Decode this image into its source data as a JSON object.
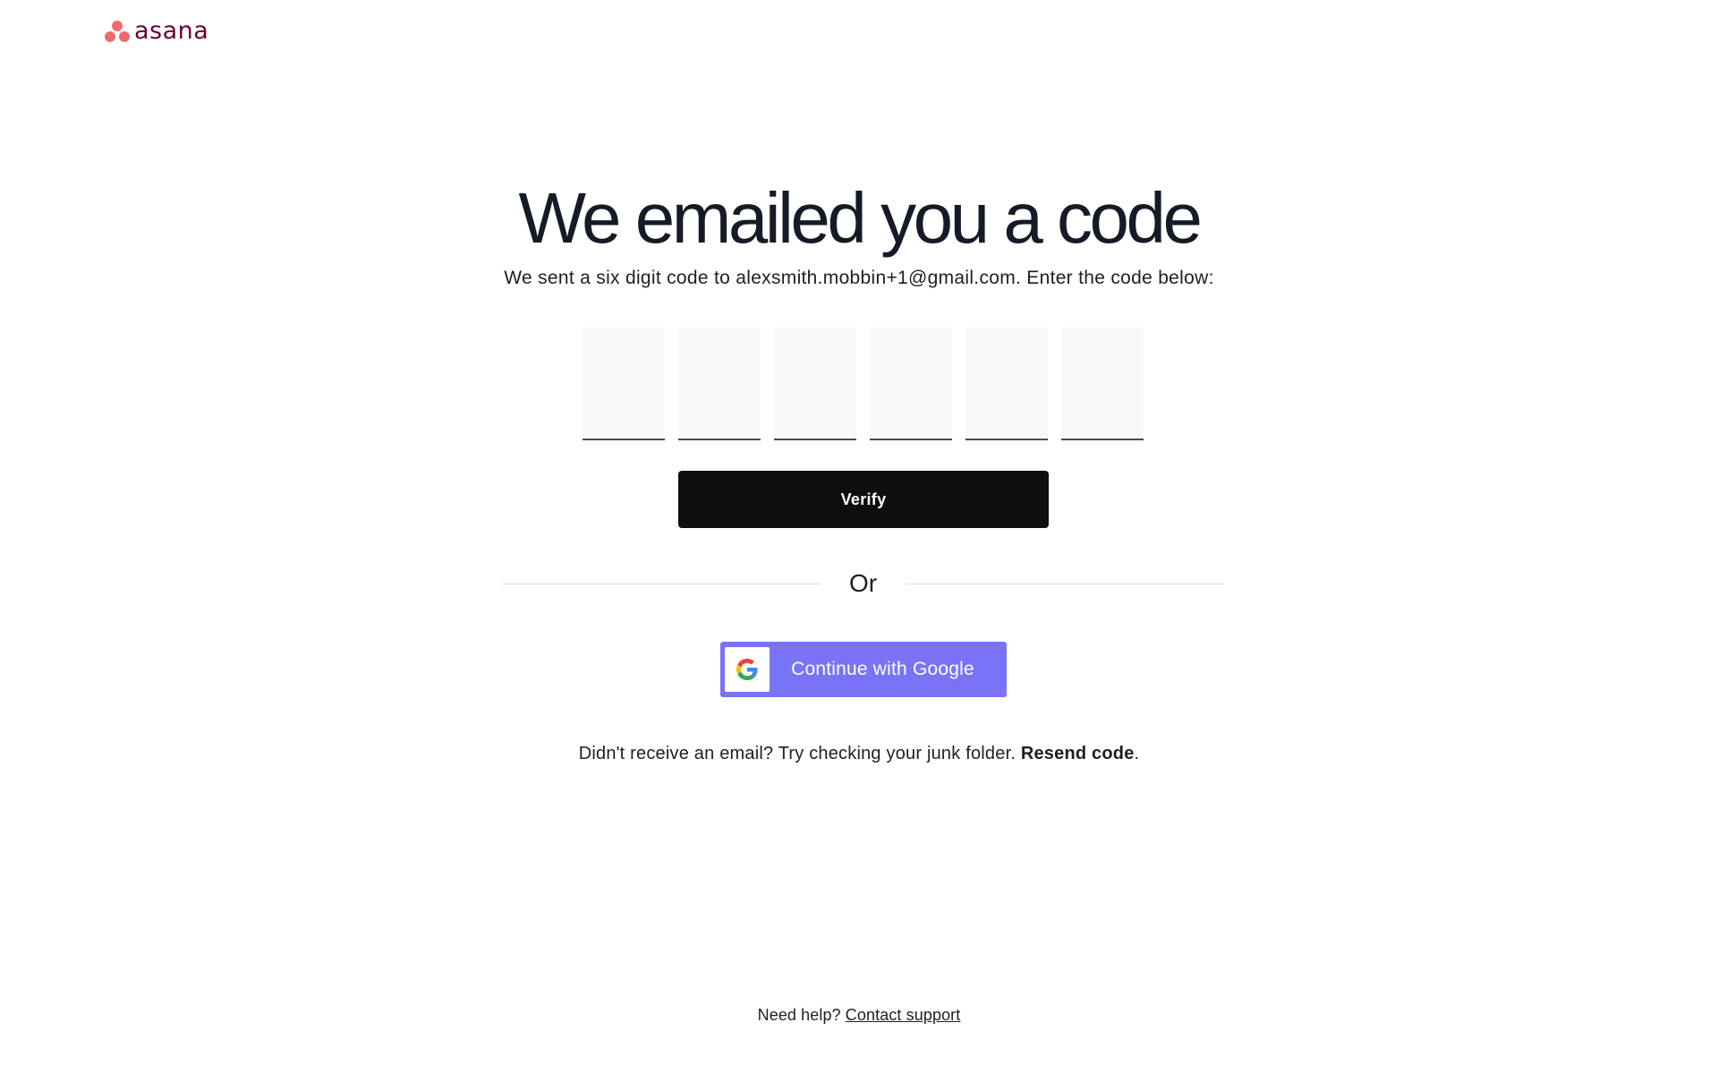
{
  "brand": {
    "name": "asana",
    "word_color": "#690031",
    "dot_color": "#f06a6a"
  },
  "heading": {
    "title": "We emailed you a code",
    "subtitle": "We sent a six digit code to alexsmith.mobbin+1@gmail.com. Enter the code below:"
  },
  "code_inputs": {
    "values": [
      "",
      "",
      "",
      "",
      "",
      ""
    ]
  },
  "actions": {
    "verify_label": "Verify",
    "divider_label": "Or",
    "google_label": "Continue with Google",
    "google_icon": "google-g-icon",
    "google_color": "#7973f8"
  },
  "resend": {
    "prefix": "Didn't receive an email? Try checking your junk folder. ",
    "link_label": "Resend code",
    "suffix": "."
  },
  "footer": {
    "prefix": "Need help? ",
    "link_label": "Contact support"
  }
}
